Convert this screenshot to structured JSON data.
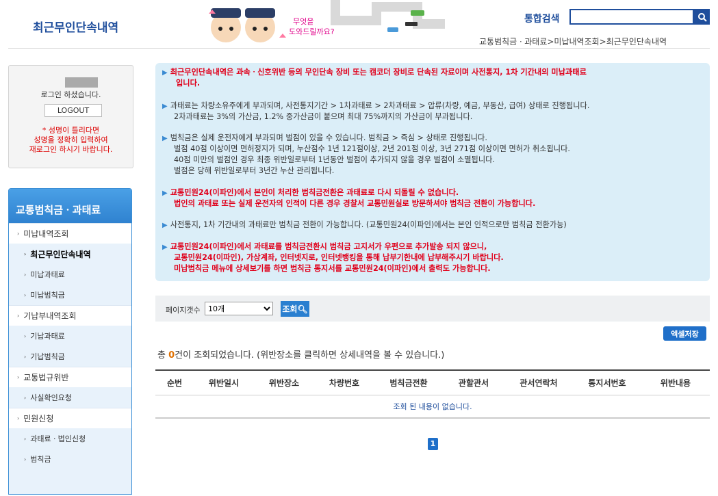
{
  "header": {
    "page_title": "최근무인단속내역",
    "mascot_text": "무엇을 도와드릴까요?",
    "search_label": "통합검색",
    "search_value": "",
    "breadcrumb": "교통범칙금ㆍ과태료>미납내역조회>최근무인단속내역"
  },
  "login": {
    "message": "로그인 하셨습니다.",
    "logout_label": "LOGOUT",
    "warning_line1": "* 성명이 틀리다면",
    "warning_line2": "성명을 정확히 입력하여",
    "warning_line3": "재로그인 하시기 바랍니다."
  },
  "menu": {
    "title": "교통범칙금ㆍ과태료",
    "items": [
      {
        "label": "미납내역조회"
      },
      {
        "label": "최근무인단속내역"
      },
      {
        "label": "미납과태료"
      },
      {
        "label": "미납범칙금"
      },
      {
        "label": "기납부내역조회"
      },
      {
        "label": "기납과태료"
      },
      {
        "label": "기납범칙금"
      },
      {
        "label": "교통법규위반"
      },
      {
        "label": "사실확인요청"
      },
      {
        "label": "민원신청"
      },
      {
        "label": "과태료ㆍ법인신청"
      },
      {
        "label": "범칙금"
      }
    ]
  },
  "notice": {
    "lines": [
      "최근무인단속내역은 과속ㆍ신호위반 등의 무인단속 장비 또는 캠코더 장비로 단속된 자료이며 사전통지, 1차 기간내의 미납과태료",
      "입니다.",
      "과태료는 차량소유주에게 부과되며, 사전통지기간 > 1차과태료 > 2차과태료 > 압류(차량, 예금, 부동산, 급여) 상태로 진행됩니다.",
      "2차과태료는 3%의 가산금, 1.2% 중가산금이 붙으며 최대 75%까지의 가산금이 부과됩니다.",
      "범칙금은 실제 운전자에게 부과되며 벌점이 있을 수 있습니다. 범칙금 > 즉심 > 상태로 진행됩니다.",
      "벌점 40점 이상이면 면허정지가 되며, 누산점수 1년 121점이상, 2년 201점 이상, 3년 271점 이상이면 면허가 취소됩니다.",
      "40점 미만의 벌점인 경우 최종 위반일로부터 1년동안 벌점이 추가되지 않을 경우 벌점이 소멸됩니다.",
      "벌점은 당해 위반일로부터 3년간 누산 관리됩니다.",
      "교통민원24(이파인)에서 본인이 처리한 범칙금전환은 과태료로 다시 되돌릴 수 없습니다.",
      "법인의 과태료 또는 실제 운전자의 인적이 다른 경우 경찰서 교통민원실로 방문하셔야 범칙금 전환이 가능합니다.",
      "사전통지, 1차 기간내의 과태료만 범칙금 전환이 가능합니다. (교통민원24(이파인)에서는 본인 인적으로만 범칙금 전환가능)",
      "교통민원24(이파인)에서 과태료를 범칙금전환시 범칙금 고지서가 우편으로 추가발송 되지 않으니,",
      "교통민원24(이파인), 가상계좌, 인터넷지로, 인터넷뱅킹을 통해 납부기한내에 납부해주시기 바랍니다.",
      "미납범칙금 메뉴에 상세보기를 하면 범칙금 통지서를 교통민원24(이파인)에서 출력도 가능합니다."
    ]
  },
  "filter": {
    "label": "페이지갯수",
    "page_size": "10개",
    "query_label": "조회"
  },
  "excel_label": "엑셀저장",
  "result": {
    "prefix": "총 ",
    "count": "0",
    "suffix": "건이 조회되었습니다. (위반장소를 클릭하면 상세내역을 볼 수 있습니다.)"
  },
  "table": {
    "headers": [
      "순번",
      "위반일시",
      "위반장소",
      "차량번호",
      "범칙금전환",
      "관할관서",
      "관서연락처",
      "통지서번호",
      "위반내용"
    ],
    "empty_message": "조회 된 내용이 없습니다."
  },
  "pager": {
    "current": "1"
  }
}
